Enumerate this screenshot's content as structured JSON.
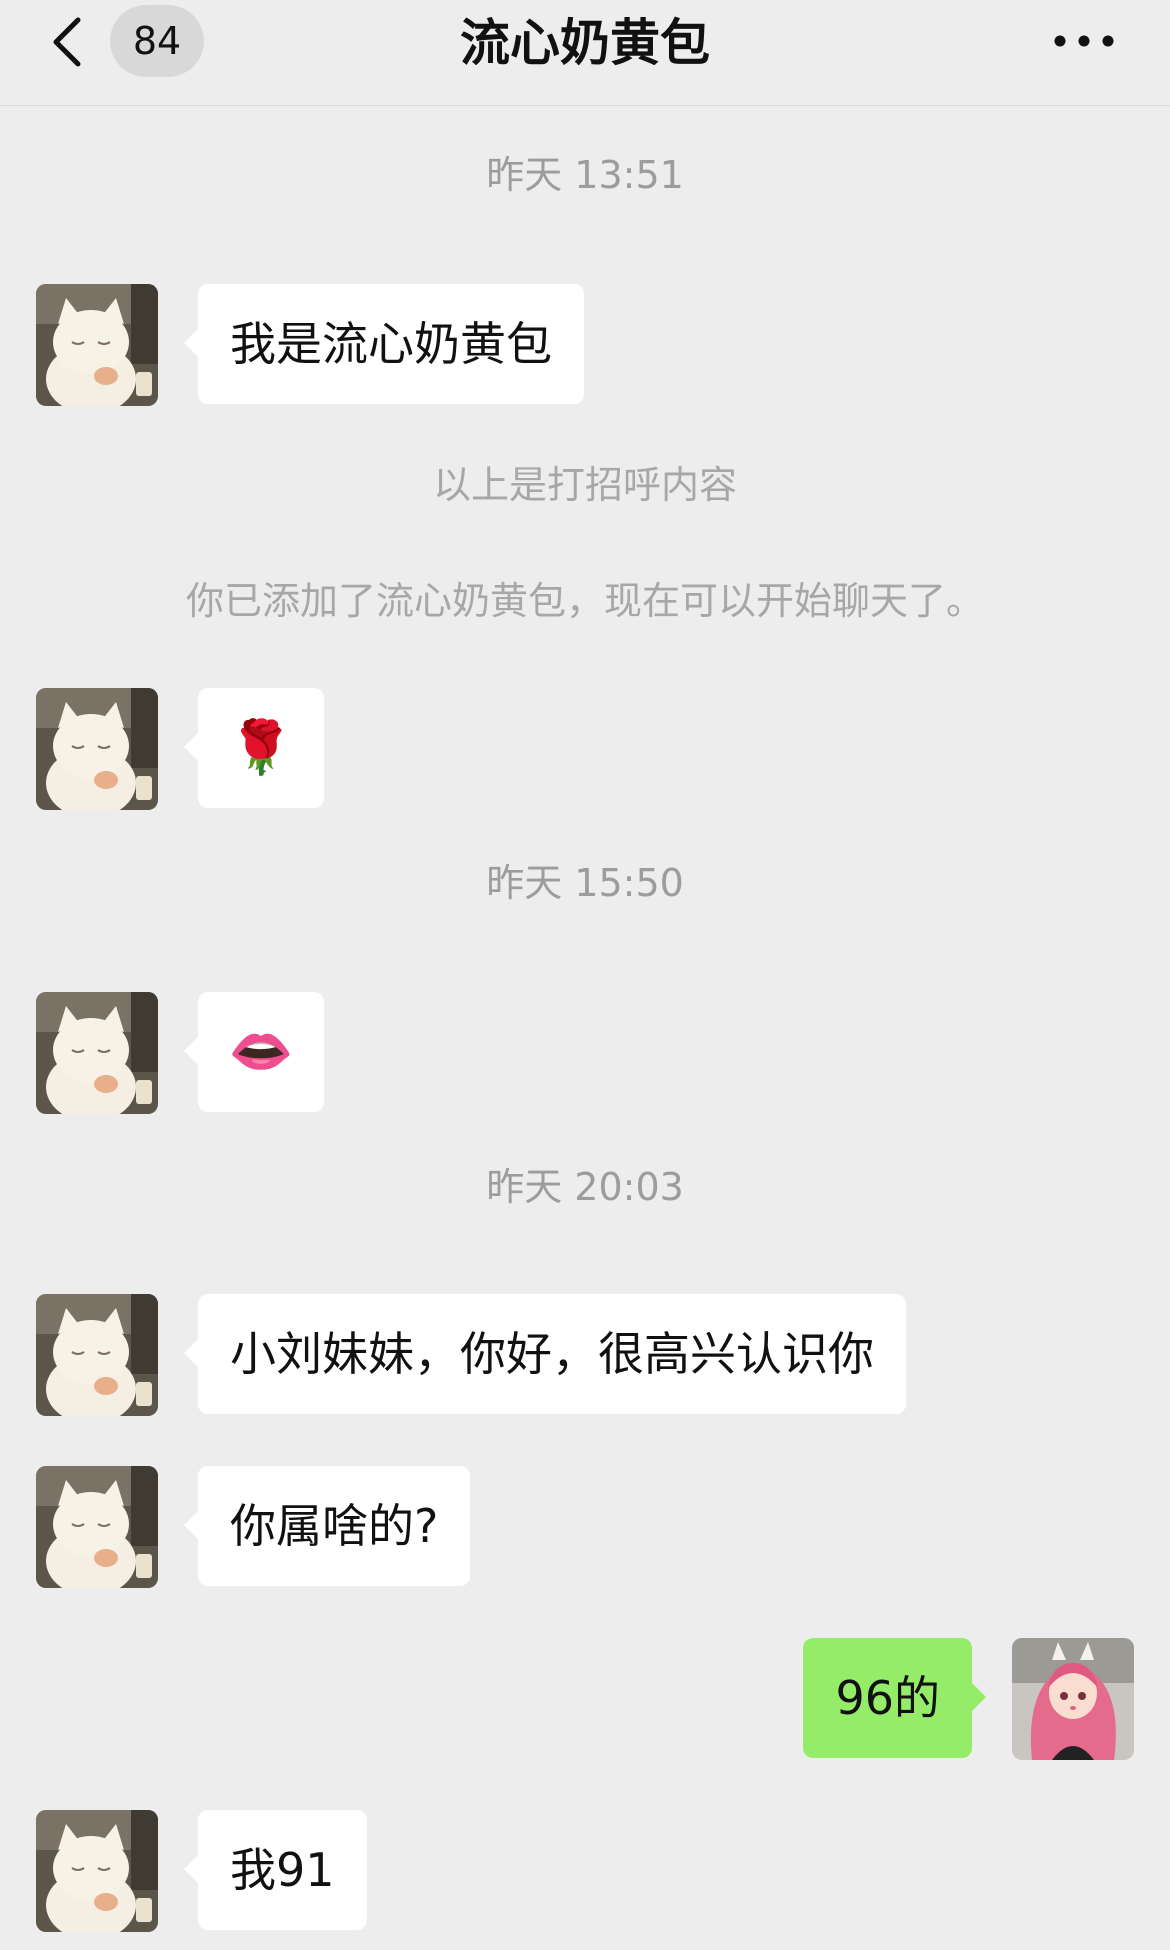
{
  "header": {
    "back_icon": "chevron-left-icon",
    "unread_count": "84",
    "title": "流心奶黄包",
    "more_icon": "more-horizontal-icon"
  },
  "messages": {
    "ts1": "昨天 13:51",
    "m1": "我是流心奶黄包",
    "sys1": "以上是打招呼内容",
    "sys2": "你已添加了流心奶黄包，现在可以开始聊天了。",
    "m2": "🌹",
    "ts2": "昨天 15:50",
    "m3": "👄",
    "ts3": "昨天 20:03",
    "m4": "小刘妹妹，你好，很高兴认识你",
    "m5": "你属啥的?",
    "m6": "96的",
    "m7": "我91"
  },
  "avatars": {
    "contact": "cat-avatar",
    "me": "anime-girl-avatar"
  },
  "colors": {
    "background": "#ededed",
    "bubble_in": "#ffffff",
    "bubble_out": "#95ec69",
    "timestamp": "#9c9c9c"
  }
}
